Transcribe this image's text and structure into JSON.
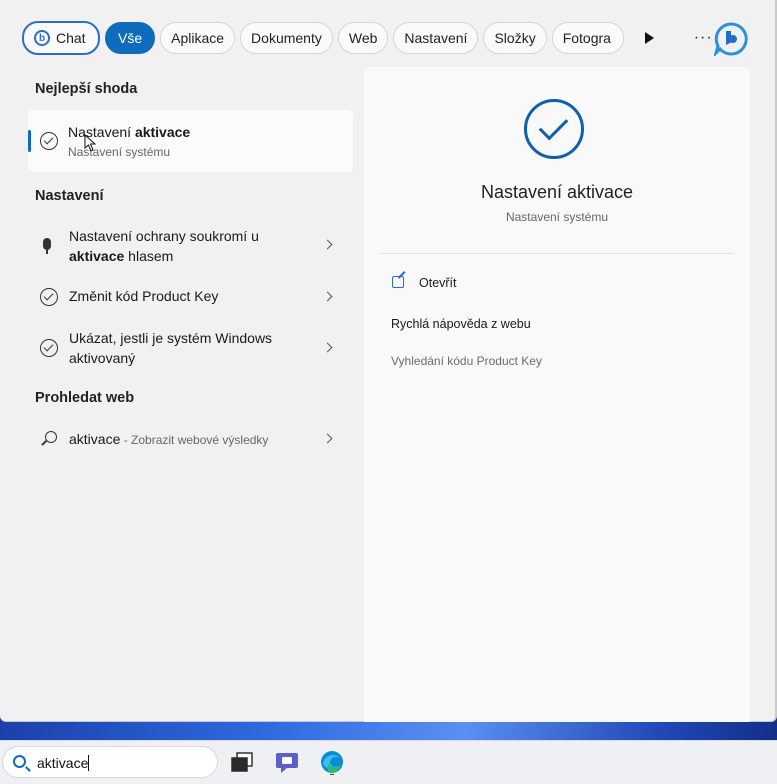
{
  "filters": {
    "chat": "Chat",
    "all": "Vše",
    "apps": "Aplikace",
    "documents": "Dokumenty",
    "web": "Web",
    "settings": "Nastavení",
    "folders": "Složky",
    "photos": "Fotogra",
    "more": "···"
  },
  "best_match": {
    "heading": "Nejlepší shoda",
    "title_plain": "Nastavení ",
    "title_bold": "aktivace",
    "subtitle": "Nastavení systému"
  },
  "settings_section": {
    "heading": "Nastavení",
    "items": [
      {
        "line1": "Nastavení ochrany soukromí u",
        "line2_bold": "aktivace",
        "line2_rest": " hlasem",
        "icon": "microphone-icon"
      },
      {
        "text": "Změnit kód Product Key",
        "icon": "check-circle-icon"
      },
      {
        "line1": "Ukázat, jestli je systém Windows",
        "line2": "aktivovaný",
        "icon": "check-circle-icon"
      }
    ]
  },
  "web_section": {
    "heading": "Prohledat web",
    "query": "aktivace",
    "suffix": " - Zobrazit webové výsledky",
    "icon": "search-icon"
  },
  "preview": {
    "title": "Nastavení aktivace",
    "subtitle": "Nastavení systému",
    "open": "Otevřít",
    "help_heading": "Rychlá nápověda z webu",
    "help_link": "Vyhledání kódu Product Key"
  },
  "taskbar": {
    "search_value": "aktivace"
  },
  "colors": {
    "accent": "#0f6cbd",
    "bing_blue": "#2b6ec7"
  }
}
